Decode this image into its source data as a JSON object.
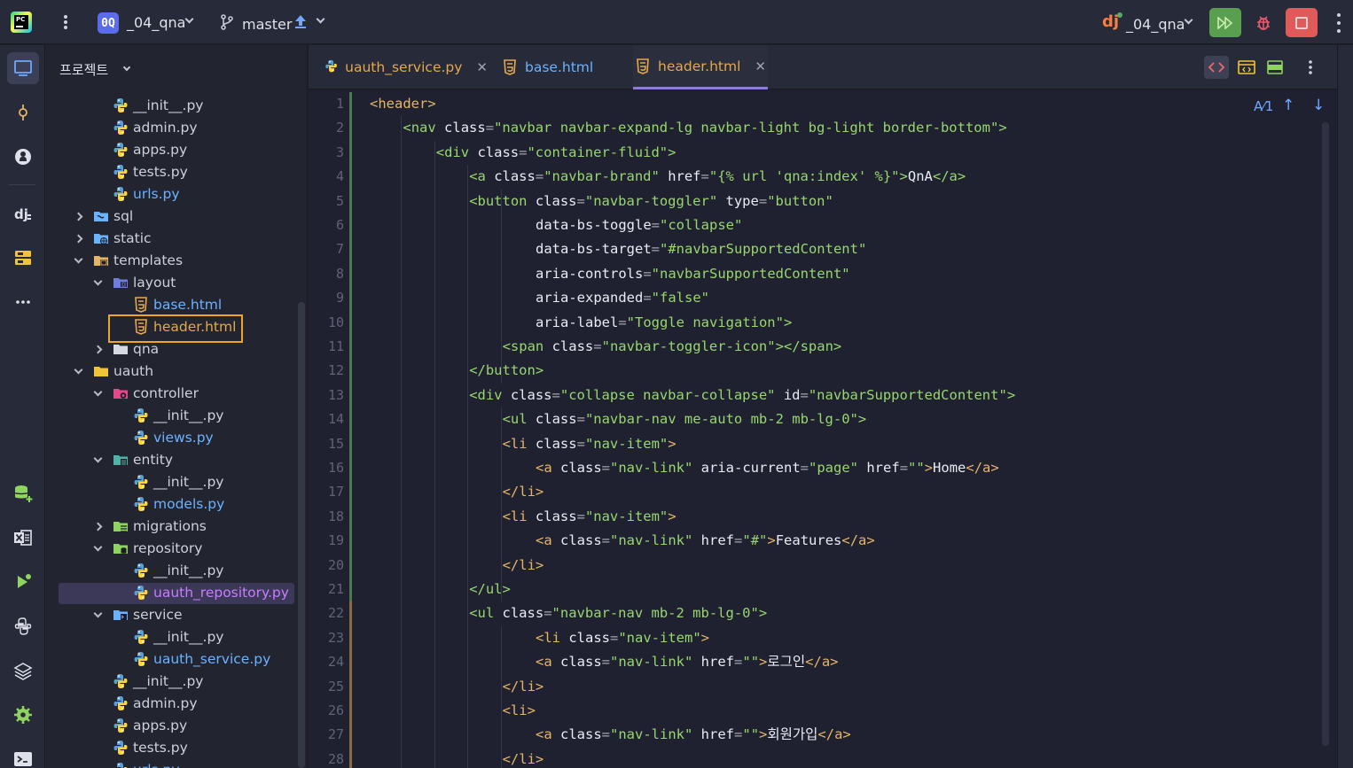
{
  "topbar": {
    "project_badge": "0Q",
    "project_name": "_04_qna",
    "branch": "master",
    "run_config": "_04_qna"
  },
  "project_panel": {
    "title": "프로젝트",
    "items": [
      {
        "label": "__init__.py",
        "type": "python",
        "depth": 3,
        "color": "default"
      },
      {
        "label": "admin.py",
        "type": "python",
        "depth": 3,
        "color": "default"
      },
      {
        "label": "apps.py",
        "type": "python",
        "depth": 3,
        "color": "default"
      },
      {
        "label": "tests.py",
        "type": "python",
        "depth": 3,
        "color": "default"
      },
      {
        "label": "urls.py",
        "type": "python",
        "depth": 3,
        "color": "blue"
      },
      {
        "label": "sql",
        "type": "folder-sql",
        "depth": 2,
        "arrow": "closed",
        "color": "default"
      },
      {
        "label": "static",
        "type": "folder-web",
        "depth": 2,
        "arrow": "closed",
        "color": "default"
      },
      {
        "label": "templates",
        "type": "folder-templates",
        "depth": 2,
        "arrow": "open",
        "color": "default"
      },
      {
        "label": "layout",
        "type": "folder-layout",
        "depth": 3,
        "arrow": "open",
        "color": "default"
      },
      {
        "label": "base.html",
        "type": "html",
        "depth": 4,
        "color": "blue"
      },
      {
        "label": "header.html",
        "type": "html",
        "depth": 4,
        "color": "orange"
      },
      {
        "label": "qna",
        "type": "folder-plain",
        "depth": 3,
        "arrow": "closed",
        "color": "default"
      },
      {
        "label": "uauth",
        "type": "folder-yellow",
        "depth": 2,
        "arrow": "open",
        "color": "default"
      },
      {
        "label": "controller",
        "type": "folder-controller",
        "depth": 3,
        "arrow": "open",
        "color": "default"
      },
      {
        "label": "__init__.py",
        "type": "python",
        "depth": 4,
        "color": "default"
      },
      {
        "label": "views.py",
        "type": "python",
        "depth": 4,
        "color": "blue"
      },
      {
        "label": "entity",
        "type": "folder-entity",
        "depth": 3,
        "arrow": "open",
        "color": "default"
      },
      {
        "label": "__init__.py",
        "type": "python",
        "depth": 4,
        "color": "default"
      },
      {
        "label": "models.py",
        "type": "python",
        "depth": 4,
        "color": "blue"
      },
      {
        "label": "migrations",
        "type": "folder-migrations",
        "depth": 3,
        "arrow": "closed",
        "color": "default"
      },
      {
        "label": "repository",
        "type": "folder-repository",
        "depth": 3,
        "arrow": "open",
        "color": "default"
      },
      {
        "label": "__init__.py",
        "type": "python",
        "depth": 4,
        "color": "default"
      },
      {
        "label": "uauth_repository.py",
        "type": "python",
        "depth": 4,
        "color": "purple",
        "selected": true
      },
      {
        "label": "service",
        "type": "folder-service",
        "depth": 3,
        "arrow": "open",
        "color": "default"
      },
      {
        "label": "__init__.py",
        "type": "python",
        "depth": 4,
        "color": "default"
      },
      {
        "label": "uauth_service.py",
        "type": "python",
        "depth": 4,
        "color": "blue"
      },
      {
        "label": "__init__.py",
        "type": "python",
        "depth": 3,
        "color": "default"
      },
      {
        "label": "admin.py",
        "type": "python",
        "depth": 3,
        "color": "default"
      },
      {
        "label": "apps.py",
        "type": "python",
        "depth": 3,
        "color": "default"
      },
      {
        "label": "tests.py",
        "type": "python",
        "depth": 3,
        "color": "default"
      },
      {
        "label": "urls.py",
        "type": "python",
        "depth": 3,
        "color": "blue"
      }
    ]
  },
  "tabs": [
    {
      "label": "uauth_service.py",
      "type": "python",
      "color": "#e5a84a",
      "closable": true,
      "active": false
    },
    {
      "label": "base.html",
      "type": "html",
      "color": "#6bb2ff",
      "closable": false,
      "active": false
    },
    {
      "label": "header.html",
      "type": "html",
      "color": "#e5a84a",
      "closable": true,
      "active": true
    }
  ],
  "editor": {
    "inspection": "1",
    "lines": [
      {
        "n": "1",
        "indent": 0,
        "parts": [
          [
            "tgo",
            "<header>"
          ]
        ]
      },
      {
        "n": "2",
        "indent": 1,
        "parts": [
          [
            "tgx",
            "<nav"
          ],
          [
            "at",
            " class"
          ],
          [
            "eq",
            "="
          ],
          [
            "av",
            "\"navbar navbar-expand-lg navbar-light bg-light border-bottom\""
          ],
          [
            "tgx",
            ">"
          ]
        ]
      },
      {
        "n": "3",
        "indent": 2,
        "parts": [
          [
            "tgx",
            "<div"
          ],
          [
            "at",
            " class"
          ],
          [
            "eq",
            "="
          ],
          [
            "av",
            "\"container-fluid\""
          ],
          [
            "tgx",
            ">"
          ]
        ]
      },
      {
        "n": "4",
        "indent": 3,
        "parts": [
          [
            "tgx",
            "<a"
          ],
          [
            "at",
            " class"
          ],
          [
            "eq",
            "="
          ],
          [
            "av",
            "\"navbar-brand\""
          ],
          [
            "at",
            " href"
          ],
          [
            "eq",
            "="
          ],
          [
            "av",
            "\"{% url 'qna:index' %}\""
          ],
          [
            "tgx",
            ">"
          ],
          [
            "txt",
            "QnA"
          ],
          [
            "tgx",
            "</a>"
          ]
        ]
      },
      {
        "n": "5",
        "indent": 3,
        "parts": [
          [
            "tgx",
            "<button"
          ],
          [
            "at",
            " class"
          ],
          [
            "eq",
            "="
          ],
          [
            "av",
            "\"navbar-toggler\""
          ],
          [
            "at",
            " type"
          ],
          [
            "eq",
            "="
          ],
          [
            "av",
            "\"button\""
          ]
        ]
      },
      {
        "n": "6",
        "indent": 5,
        "parts": [
          [
            "at",
            "data-bs-toggle"
          ],
          [
            "eq",
            "="
          ],
          [
            "av",
            "\"collapse\""
          ]
        ]
      },
      {
        "n": "7",
        "indent": 5,
        "parts": [
          [
            "at",
            "data-bs-target"
          ],
          [
            "eq",
            "="
          ],
          [
            "av",
            "\"#navbarSupportedContent\""
          ]
        ]
      },
      {
        "n": "8",
        "indent": 5,
        "parts": [
          [
            "at",
            "aria-controls"
          ],
          [
            "eq",
            "="
          ],
          [
            "av",
            "\"navbarSupportedContent\""
          ]
        ]
      },
      {
        "n": "9",
        "indent": 5,
        "parts": [
          [
            "at",
            "aria-expanded"
          ],
          [
            "eq",
            "="
          ],
          [
            "av",
            "\"false\""
          ]
        ]
      },
      {
        "n": "10",
        "indent": 5,
        "parts": [
          [
            "at",
            "aria-label"
          ],
          [
            "eq",
            "="
          ],
          [
            "av",
            "\"Toggle navigation\""
          ],
          [
            "tgx",
            ">"
          ]
        ]
      },
      {
        "n": "11",
        "indent": 4,
        "parts": [
          [
            "tgx",
            "<span"
          ],
          [
            "at",
            " class"
          ],
          [
            "eq",
            "="
          ],
          [
            "av",
            "\"navbar-toggler-icon\""
          ],
          [
            "tgx",
            "></span>"
          ]
        ]
      },
      {
        "n": "12",
        "indent": 3,
        "parts": [
          [
            "tgx",
            "</button>"
          ]
        ]
      },
      {
        "n": "13",
        "indent": 3,
        "parts": [
          [
            "tgx",
            "<div"
          ],
          [
            "at",
            " class"
          ],
          [
            "eq",
            "="
          ],
          [
            "av",
            "\"collapse navbar-collapse\""
          ],
          [
            "at",
            " id"
          ],
          [
            "eq",
            "="
          ],
          [
            "av",
            "\"navbarSupportedContent\""
          ],
          [
            "tgx",
            ">"
          ]
        ]
      },
      {
        "n": "14",
        "indent": 4,
        "parts": [
          [
            "tgx",
            "<ul"
          ],
          [
            "at",
            " class"
          ],
          [
            "eq",
            "="
          ],
          [
            "av",
            "\"navbar-nav me-auto mb-2 mb-lg-0\""
          ],
          [
            "tgx",
            ">"
          ]
        ]
      },
      {
        "n": "15",
        "indent": 4,
        "parts": [
          [
            "tgo",
            "<li"
          ],
          [
            "at",
            " class"
          ],
          [
            "eq",
            "="
          ],
          [
            "av",
            "\"nav-item\""
          ],
          [
            "tgo",
            ">"
          ]
        ]
      },
      {
        "n": "16",
        "indent": 5,
        "parts": [
          [
            "tgo",
            "<a"
          ],
          [
            "at",
            " class"
          ],
          [
            "eq",
            "="
          ],
          [
            "av",
            "\"nav-link\""
          ],
          [
            "at",
            " aria-current"
          ],
          [
            "eq",
            "="
          ],
          [
            "av",
            "\"page\""
          ],
          [
            "at",
            " href"
          ],
          [
            "eq",
            "="
          ],
          [
            "av",
            "\"\""
          ],
          [
            "tgo",
            ">"
          ],
          [
            "txt",
            "Home"
          ],
          [
            "tgo",
            "</a>"
          ]
        ]
      },
      {
        "n": "17",
        "indent": 4,
        "parts": [
          [
            "tgo",
            "</li>"
          ]
        ]
      },
      {
        "n": "18",
        "indent": 4,
        "parts": [
          [
            "tgo",
            "<li"
          ],
          [
            "at",
            " class"
          ],
          [
            "eq",
            "="
          ],
          [
            "av",
            "\"nav-item\""
          ],
          [
            "tgo",
            ">"
          ]
        ]
      },
      {
        "n": "19",
        "indent": 5,
        "parts": [
          [
            "tgo",
            "<a"
          ],
          [
            "at",
            " class"
          ],
          [
            "eq",
            "="
          ],
          [
            "av",
            "\"nav-link\""
          ],
          [
            "at",
            " href"
          ],
          [
            "eq",
            "="
          ],
          [
            "av",
            "\"#\""
          ],
          [
            "tgo",
            ">"
          ],
          [
            "txt",
            "Features"
          ],
          [
            "tgo",
            "</a>"
          ]
        ]
      },
      {
        "n": "20",
        "indent": 4,
        "parts": [
          [
            "tgo",
            "</li>"
          ]
        ]
      },
      {
        "n": "21",
        "indent": 3,
        "parts": [
          [
            "tgx",
            "</ul>"
          ]
        ]
      },
      {
        "n": "22",
        "indent": 3,
        "parts": [
          [
            "tgx",
            "<ul"
          ],
          [
            "at",
            " class"
          ],
          [
            "eq",
            "="
          ],
          [
            "av",
            "\"navbar-nav mb-2 mb-lg-0\""
          ],
          [
            "tgx",
            ">"
          ]
        ]
      },
      {
        "n": "23",
        "indent": 5,
        "parts": [
          [
            "tgo",
            "<li"
          ],
          [
            "at",
            " class"
          ],
          [
            "eq",
            "="
          ],
          [
            "av",
            "\"nav-item\""
          ],
          [
            "tgo",
            ">"
          ]
        ]
      },
      {
        "n": "24",
        "indent": 5,
        "parts": [
          [
            "tgo",
            "<a"
          ],
          [
            "at",
            " class"
          ],
          [
            "eq",
            "="
          ],
          [
            "av",
            "\"nav-link\""
          ],
          [
            "at",
            " href"
          ],
          [
            "eq",
            "="
          ],
          [
            "av",
            "\"\""
          ],
          [
            "tgo",
            ">"
          ],
          [
            "txt",
            "로그인"
          ],
          [
            "tgo",
            "</a>"
          ]
        ]
      },
      {
        "n": "25",
        "indent": 4,
        "parts": [
          [
            "tgo",
            "</li>"
          ]
        ]
      },
      {
        "n": "26",
        "indent": 4,
        "parts": [
          [
            "tgo",
            "<li>"
          ]
        ]
      },
      {
        "n": "27",
        "indent": 5,
        "parts": [
          [
            "tgo",
            "<a"
          ],
          [
            "at",
            " class"
          ],
          [
            "eq",
            "="
          ],
          [
            "av",
            "\"nav-link\""
          ],
          [
            "at",
            " href"
          ],
          [
            "eq",
            "="
          ],
          [
            "av",
            "\"\""
          ],
          [
            "tgo",
            ">"
          ],
          [
            "txt",
            "회원가입"
          ],
          [
            "tgo",
            "</a>"
          ]
        ]
      },
      {
        "n": "28",
        "indent": 4,
        "parts": [
          [
            "tgo",
            "</li>"
          ]
        ]
      }
    ]
  }
}
